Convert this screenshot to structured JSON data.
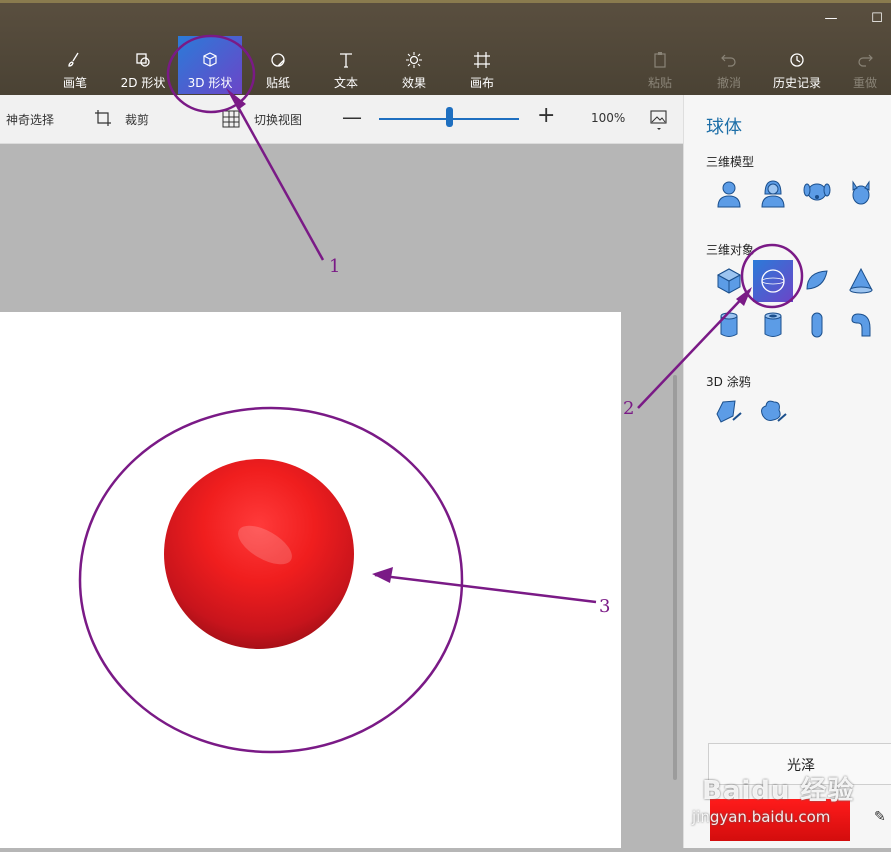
{
  "window": {
    "minimize_icon": "minimize-icon",
    "maximize_icon": "maximize-icon"
  },
  "toolbar": {
    "items": [
      {
        "label": "画笔",
        "icon": "brush-icon"
      },
      {
        "label": "2D 形状",
        "icon": "2d-shapes-icon"
      },
      {
        "label": "3D 形状",
        "icon": "3d-cube-icon",
        "selected": true
      },
      {
        "label": "贴纸",
        "icon": "sticker-icon"
      },
      {
        "label": "文本",
        "icon": "text-icon"
      },
      {
        "label": "效果",
        "icon": "effects-sun-icon"
      },
      {
        "label": "画布",
        "icon": "canvas-icon"
      }
    ],
    "right_items": [
      {
        "label": "粘贴",
        "icon": "paste-icon",
        "enabled": false
      },
      {
        "label": "撤消",
        "icon": "undo-icon",
        "enabled": false
      },
      {
        "label": "历史记录",
        "icon": "history-icon",
        "enabled": true
      },
      {
        "label": "重做",
        "icon": "redo-icon",
        "enabled": false
      }
    ]
  },
  "subbar": {
    "magic_select": "神奇选择",
    "crop": "裁剪",
    "toggle_view": "切换视图",
    "zoom_minus": "—",
    "zoom_plus": "+",
    "zoom_percent": "100%",
    "zoom_level": 0.5
  },
  "panel": {
    "title": "球体",
    "models_label": "三维模型",
    "objects_label": "三维对象",
    "doodle_label": "3D 涂鸦",
    "sheen_label": "光泽",
    "color": "#ff1b1b"
  },
  "annotations": {
    "n1": "1",
    "n2": "2",
    "n3": "3",
    "color": "#7a1a86"
  },
  "watermark": {
    "main": "Baidu 经验",
    "sub": "jingyan.baidu.com"
  }
}
